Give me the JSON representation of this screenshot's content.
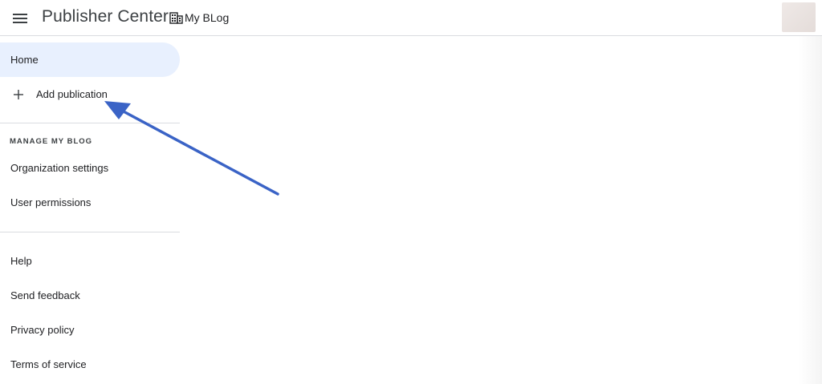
{
  "header": {
    "app_title": "Publisher Center",
    "org_name": "My BLog",
    "menu_icon": "hamburger-menu-icon",
    "org_icon": "building-icon"
  },
  "sidebar": {
    "home_label": "Home",
    "add_publication_label": "Add publication",
    "manage_section_title": "MANAGE MY BLOG",
    "organization_settings_label": "Organization settings",
    "user_permissions_label": "User permissions",
    "help_label": "Help",
    "send_feedback_label": "Send feedback",
    "privacy_policy_label": "Privacy policy",
    "terms_of_service_label": "Terms of service"
  },
  "colors": {
    "active_bg": "#e8f0fe",
    "annotation_arrow": "#3a63c6",
    "divider": "#dadce0"
  }
}
